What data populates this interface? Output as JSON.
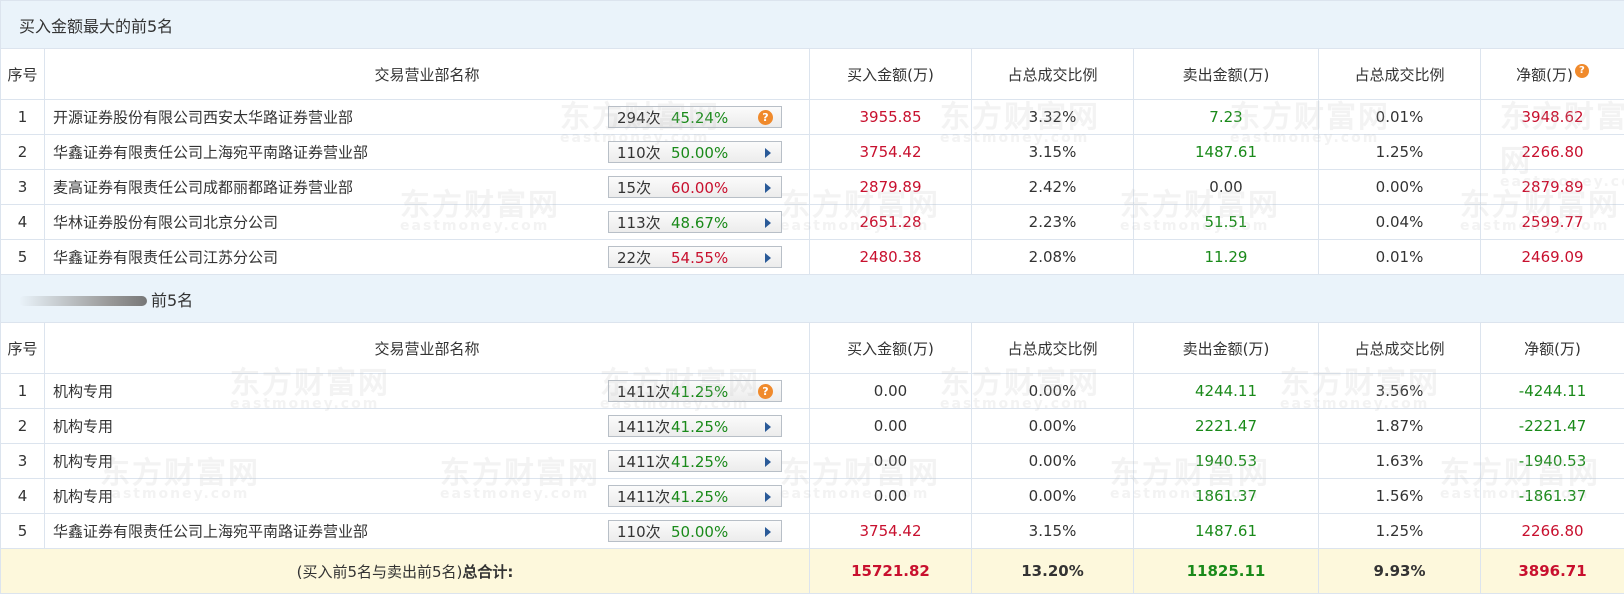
{
  "buy_section": {
    "title": "买入金额最大的前5名",
    "headers": [
      "序号",
      "交易营业部名称",
      "买入金额(万)",
      "占总成交比例",
      "卖出金额(万)",
      "占总成交比例",
      "净额(万)"
    ],
    "help_icon": "question-circle-icon",
    "rows": [
      {
        "no": "1",
        "name": "开源证券股份有限公司西安太华路证券营业部",
        "count": "294次",
        "pct": "45.24%",
        "icon": "question-circle-icon",
        "buy": "3955.85",
        "buy_ratio": "3.32%",
        "sell": "7.23",
        "sell_ratio": "0.01%",
        "net": "3948.62"
      },
      {
        "no": "2",
        "name": "华鑫证券有限责任公司上海宛平南路证券营业部",
        "count": "110次",
        "pct": "50.00%",
        "icon": "triangle-right-icon",
        "buy": "3754.42",
        "buy_ratio": "3.15%",
        "sell": "1487.61",
        "sell_ratio": "1.25%",
        "net": "2266.80"
      },
      {
        "no": "3",
        "name": "麦高证券有限责任公司成都丽都路证券营业部",
        "count": "15次",
        "pct": "60.00%",
        "icon": "triangle-right-icon",
        "buy": "2879.89",
        "buy_ratio": "2.42%",
        "sell": "0.00",
        "sell_ratio": "0.00%",
        "net": "2879.89"
      },
      {
        "no": "4",
        "name": "华林证券股份有限公司北京分公司",
        "count": "113次",
        "pct": "48.67%",
        "icon": "triangle-right-icon",
        "buy": "2651.28",
        "buy_ratio": "2.23%",
        "sell": "51.51",
        "sell_ratio": "0.04%",
        "net": "2599.77"
      },
      {
        "no": "5",
        "name": "华鑫证券有限责任公司江苏分公司",
        "count": "22次",
        "pct": "54.55%",
        "icon": "triangle-right-icon",
        "buy": "2480.38",
        "buy_ratio": "2.08%",
        "sell": "11.29",
        "sell_ratio": "0.01%",
        "net": "2469.09"
      }
    ]
  },
  "sell_section": {
    "title": "前5名",
    "headers": [
      "序号",
      "交易营业部名称",
      "买入金额(万)",
      "占总成交比例",
      "卖出金额(万)",
      "占总成交比例",
      "净额(万)"
    ],
    "rows": [
      {
        "no": "1",
        "name": "机构专用",
        "count": "1411次",
        "pct": "41.25%",
        "icon": "question-circle-icon",
        "buy": "0.00",
        "buy_ratio": "0.00%",
        "sell": "4244.11",
        "sell_ratio": "3.56%",
        "net": "-4244.11"
      },
      {
        "no": "2",
        "name": "机构专用",
        "count": "1411次",
        "pct": "41.25%",
        "icon": "triangle-right-icon",
        "buy": "0.00",
        "buy_ratio": "0.00%",
        "sell": "2221.47",
        "sell_ratio": "1.87%",
        "net": "-2221.47"
      },
      {
        "no": "3",
        "name": "机构专用",
        "count": "1411次",
        "pct": "41.25%",
        "icon": "triangle-right-icon",
        "buy": "0.00",
        "buy_ratio": "0.00%",
        "sell": "1940.53",
        "sell_ratio": "1.63%",
        "net": "-1940.53"
      },
      {
        "no": "4",
        "name": "机构专用",
        "count": "1411次",
        "pct": "41.25%",
        "icon": "triangle-right-icon",
        "buy": "0.00",
        "buy_ratio": "0.00%",
        "sell": "1861.37",
        "sell_ratio": "1.56%",
        "net": "-1861.37"
      },
      {
        "no": "5",
        "name": "华鑫证券有限责任公司上海宛平南路证券营业部",
        "count": "110次",
        "pct": "50.00%",
        "icon": "triangle-right-icon",
        "buy": "3754.42",
        "buy_ratio": "3.15%",
        "sell": "1487.61",
        "sell_ratio": "1.25%",
        "net": "2266.80"
      }
    ]
  },
  "total": {
    "label_prefix": "(买入前5名与卖出前5名)",
    "label_bold": "总合计:",
    "buy": "15721.82",
    "buy_ratio": "13.20%",
    "sell": "11825.11",
    "sell_ratio": "9.93%",
    "net": "3896.71"
  },
  "watermark": {
    "cn": "东方财富网",
    "en": "eastmoney.com"
  },
  "colors": {
    "red": "#c8102e",
    "green": "#1a8a1a",
    "header_bg": "#eaf3fa",
    "total_bg": "#fdf8dc",
    "help_icon": "#f08a2c"
  }
}
